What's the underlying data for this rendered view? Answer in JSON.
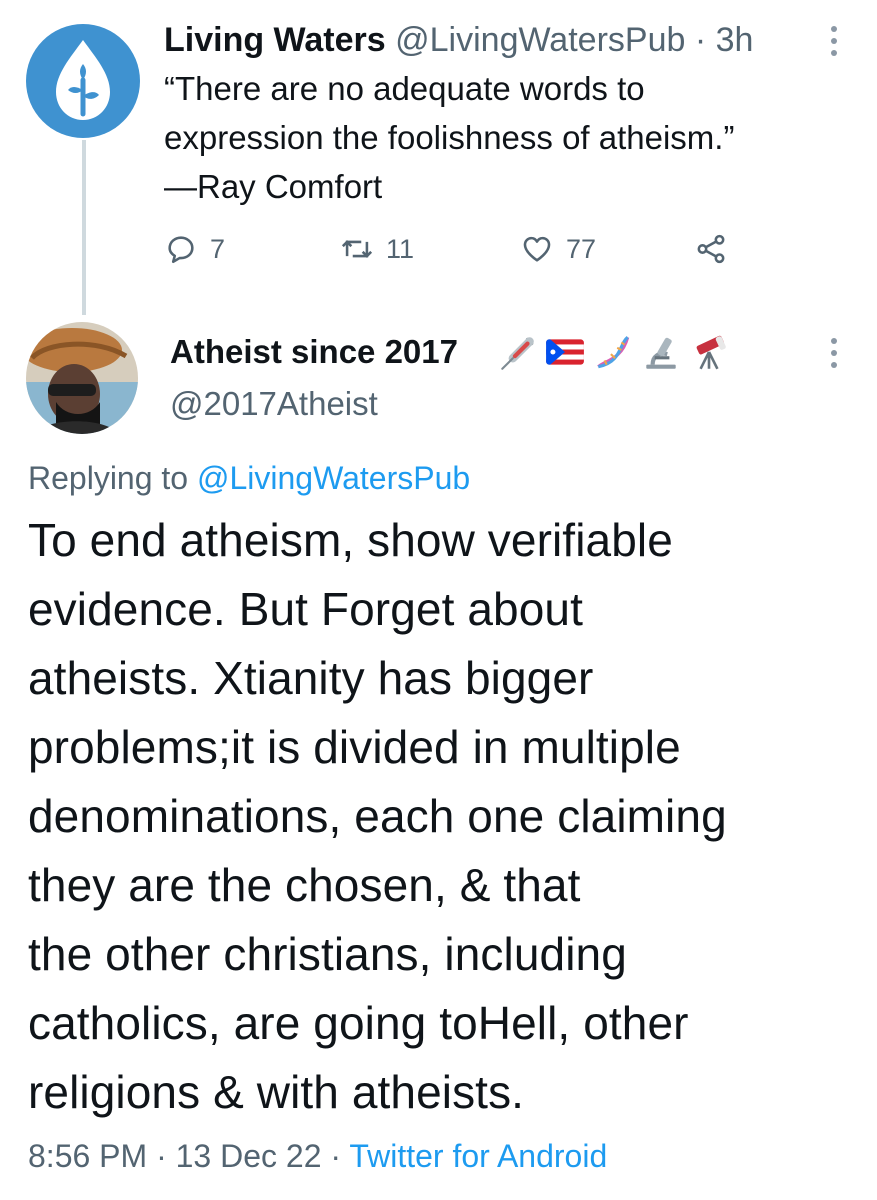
{
  "parent_tweet": {
    "display_name": "Living Waters",
    "handle": "@LivingWatersPub",
    "separator": "·",
    "time": "3h",
    "text_lines": [
      "“There are no adequate words to",
      "expression the foolishness of atheism.”",
      "—Ray Comfort"
    ],
    "avatar_icon": "plant-drop-logo",
    "avatar_color": "#3f92d0",
    "actions": {
      "reply_count": "7",
      "retweet_count": "11",
      "like_count": "77"
    }
  },
  "reply_tweet": {
    "display_name": "Atheist since 2017",
    "emoji_icons": [
      "syringe-icon",
      "puerto-rico-flag-icon",
      "dna-icon",
      "microscope-icon",
      "telescope-icon"
    ],
    "handle": "@2017Atheist",
    "replying_prefix": "Replying to",
    "replying_to": "@LivingWatersPub",
    "text_lines": [
      "To end atheism, show verifiable",
      "evidence. But Forget about",
      "atheists. Xtianity has bigger",
      "problems;it is divided in multiple",
      "denominations, each one claiming",
      "they are the chosen, & that",
      "the other christians, including",
      "catholics, are going toHell, other",
      "religions & with atheists."
    ],
    "time": "8:56 PM",
    "date": "13 Dec 22",
    "separator": "·",
    "source": "Twitter for Android"
  },
  "colors": {
    "link": "#1d9bf0",
    "muted": "#536471",
    "text": "#0f1419",
    "thread_line": "#cfd9de"
  }
}
